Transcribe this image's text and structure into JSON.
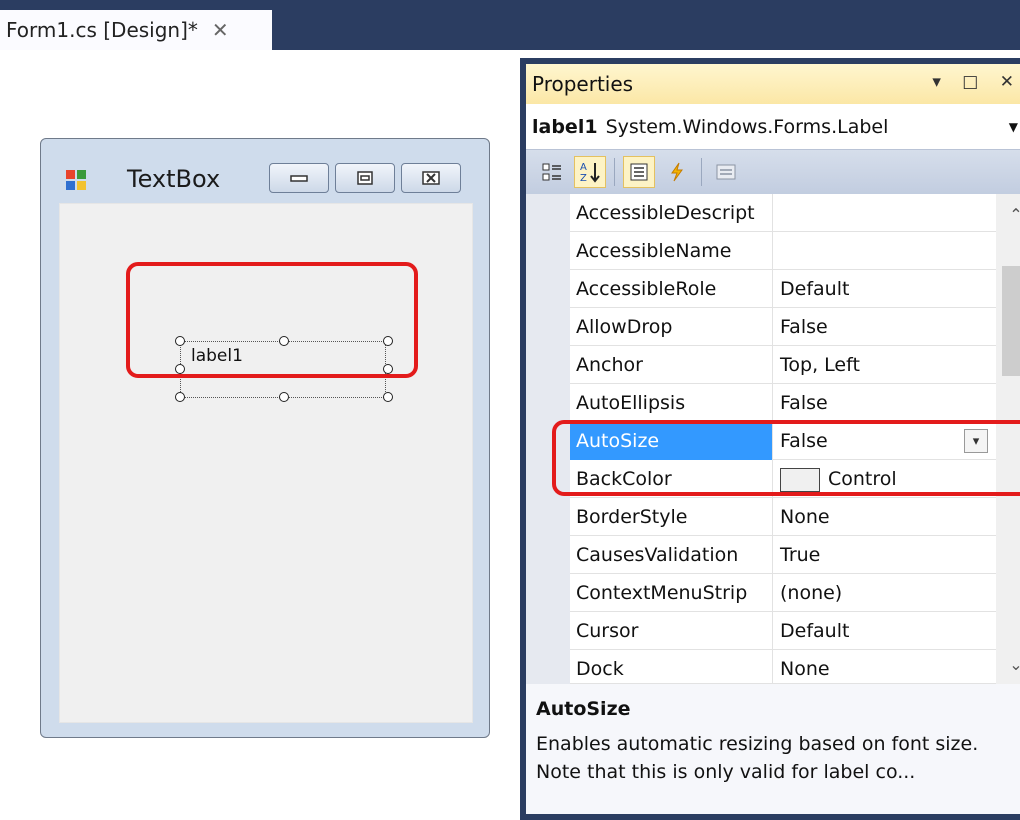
{
  "document_tab": {
    "label": "Form1.cs [Design]*",
    "close_glyph": "✕"
  },
  "form": {
    "title": "TextBox",
    "icon": "windows-form-icon",
    "buttons": [
      "minimize-icon",
      "maximize-icon",
      "close-icon"
    ],
    "label_text": "label1"
  },
  "properties": {
    "title": "Properties",
    "header_icons": "▾ □ ✕",
    "object_name": "label1",
    "object_type": "System.Windows.Forms.Label",
    "toolbar": {
      "categorized": "categorized-icon",
      "alphabetical": "az-sort-icon",
      "properties": "properties-icon",
      "events": "lightning-icon",
      "pages": "property-pages-icon"
    },
    "rows": [
      {
        "name": "AccessibleDescript",
        "value": ""
      },
      {
        "name": "AccessibleName",
        "value": ""
      },
      {
        "name": "AccessibleRole",
        "value": "Default"
      },
      {
        "name": "AllowDrop",
        "value": "False"
      },
      {
        "name": "Anchor",
        "value": "Top, Left"
      },
      {
        "name": "AutoEllipsis",
        "value": "False"
      },
      {
        "name": "AutoSize",
        "value": "False"
      },
      {
        "name": "BackColor",
        "value": "Control"
      },
      {
        "name": "BorderStyle",
        "value": "None"
      },
      {
        "name": "CausesValidation",
        "value": "True"
      },
      {
        "name": "ContextMenuStrip",
        "value": "(none)"
      },
      {
        "name": "Cursor",
        "value": "Default"
      },
      {
        "name": "Dock",
        "value": "None"
      }
    ],
    "selected_row": "AutoSize",
    "description": {
      "title": "AutoSize",
      "text": "Enables automatic resizing based on font size. Note that this is only valid for label co..."
    }
  },
  "colors": {
    "highlight_red": "#e31b1b",
    "selection_blue": "#3399ff",
    "chrome_navy": "#2b3d61"
  }
}
